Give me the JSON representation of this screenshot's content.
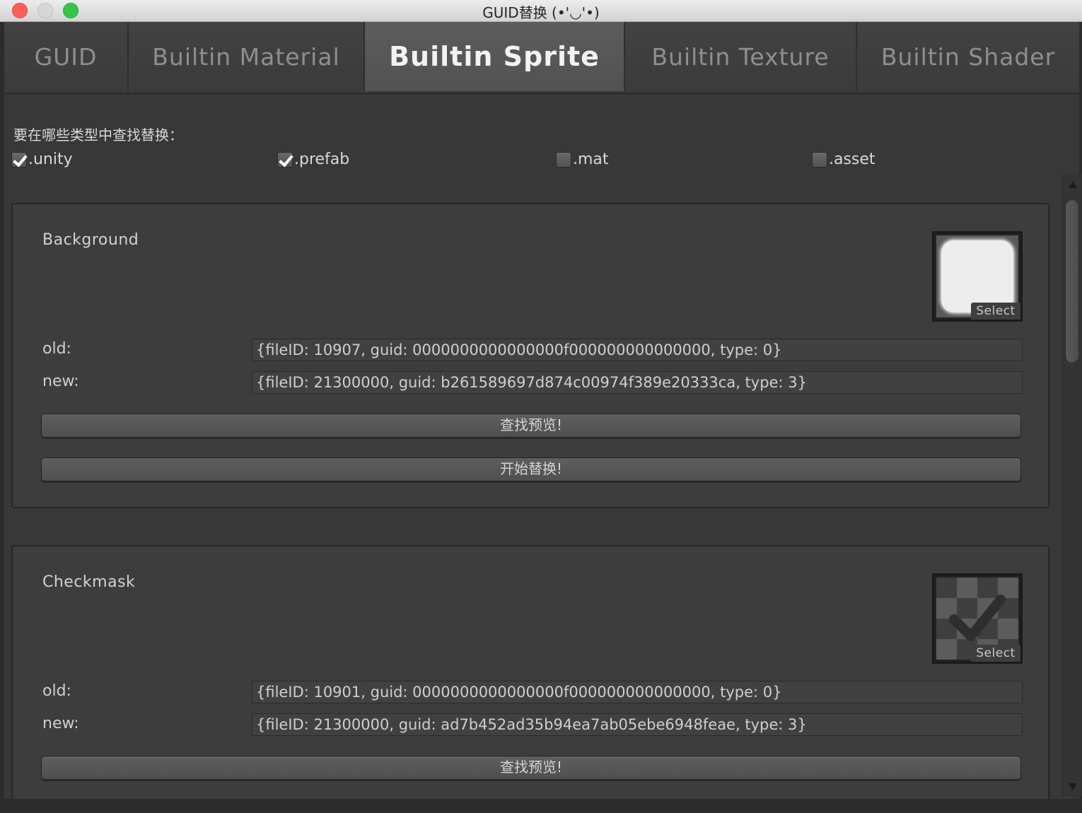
{
  "window": {
    "title": "GUID替换 (•'◡'•)"
  },
  "tabs": [
    {
      "label": "GUID",
      "active": false
    },
    {
      "label": "Builtin Material",
      "active": false
    },
    {
      "label": "Builtin Sprite",
      "active": true
    },
    {
      "label": "Builtin Texture",
      "active": false
    },
    {
      "label": "Builtin Shader",
      "active": false
    }
  ],
  "filter": {
    "prompt": "要在哪些类型中查找替换：",
    "types": [
      {
        "label": ".unity",
        "checked": true
      },
      {
        "label": ".prefab",
        "checked": true
      },
      {
        "label": ".mat",
        "checked": false
      },
      {
        "label": ".asset",
        "checked": false
      }
    ]
  },
  "panels": [
    {
      "title": "Background",
      "thumbnail_icon": "rounded-white-square-icon",
      "select_label": "Select",
      "old_label": "old:",
      "old_value": "{fileID: 10907, guid: 0000000000000000f000000000000000, type: 0}",
      "new_label": "new:",
      "new_value": "{fileID: 21300000, guid: b261589697d874c00974f389e20333ca, type: 3}",
      "preview_button": "查找预览!",
      "replace_button": "开始替换!"
    },
    {
      "title": "Checkmask",
      "thumbnail_icon": "checkmark-checker-icon",
      "select_label": "Select",
      "old_label": "old:",
      "old_value": "{fileID: 10901, guid: 0000000000000000f000000000000000, type: 0}",
      "new_label": "new:",
      "new_value": "{fileID: 21300000, guid: ad7b452ad35b94ea7ab05ebe6948feae, type: 3}",
      "preview_button": "查找预览!"
    }
  ],
  "colors": {
    "close": "#fc5f57",
    "minimize": "#d7d7d7",
    "maximize": "#33c748",
    "background": "#383838",
    "panel": "#3d3d3d"
  }
}
